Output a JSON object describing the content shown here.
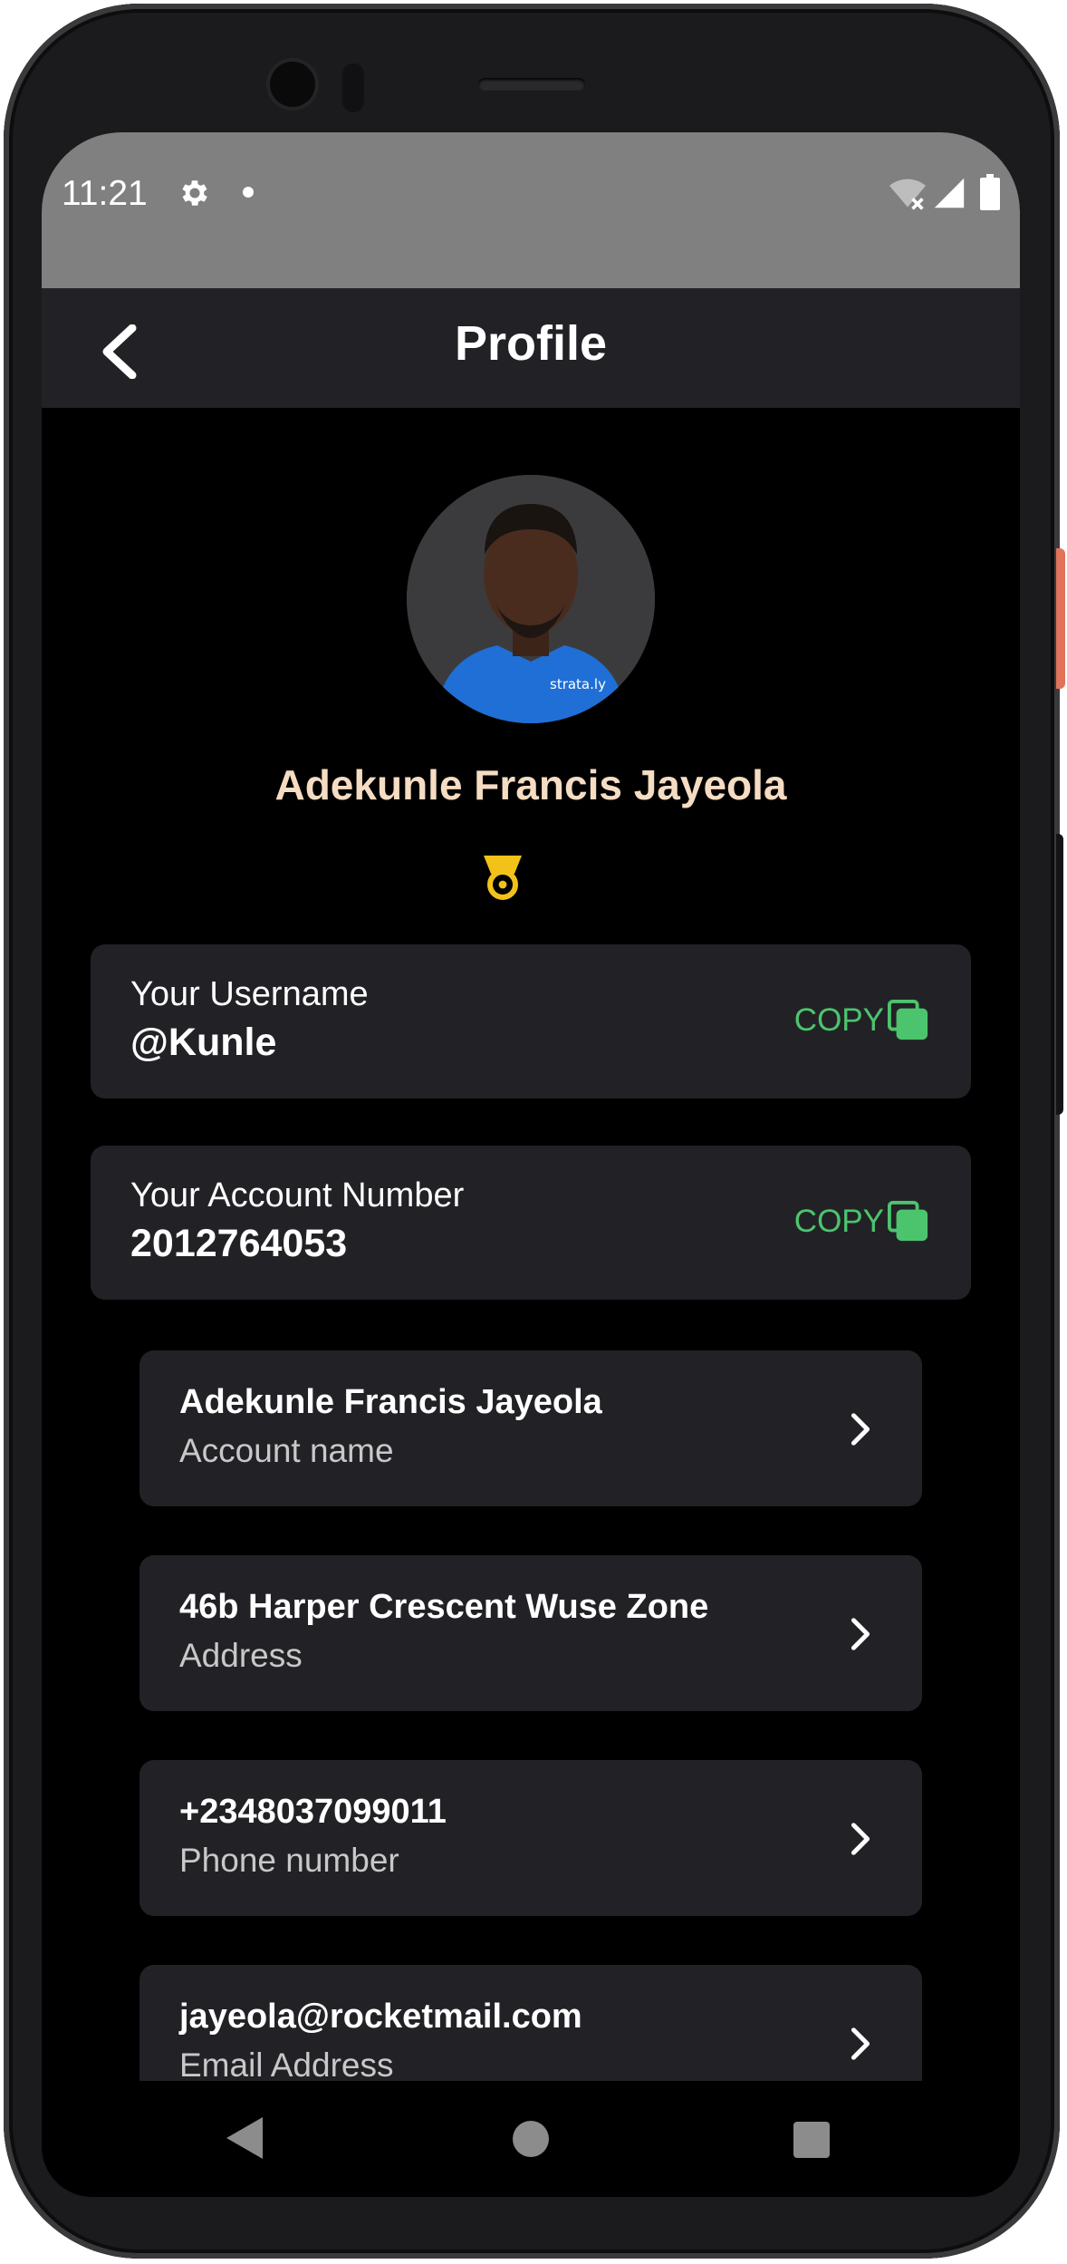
{
  "status_bar": {
    "time": "11:21",
    "icons": [
      "gear-icon",
      "notification-dot-icon",
      "wifi-off-icon",
      "cell-signal-icon",
      "battery-icon"
    ]
  },
  "app_bar": {
    "title": "Profile",
    "back_icon": "chevron-left-icon"
  },
  "profile": {
    "name": "Adekunle Francis Jayeola",
    "avatar_shirt_text": "strata.ly",
    "badge_icon": "medal-icon"
  },
  "username_card": {
    "label": "Your Username",
    "value": "@Kunle",
    "copy_label": "COPY"
  },
  "account_card": {
    "label": "Your Account Number",
    "value": "2012764053",
    "copy_label": "COPY"
  },
  "details": [
    {
      "value": "Adekunle Francis Jayeola",
      "label": "Account name"
    },
    {
      "value": "46b Harper Crescent Wuse Zone",
      "label": "Address"
    },
    {
      "value": "+2348037099011",
      "label": "Phone number"
    },
    {
      "value": "jayeola@rocketmail.com",
      "label": "Email Address"
    }
  ],
  "nav_bar": {
    "icons": [
      "back-triangle-icon",
      "home-circle-icon",
      "recents-square-icon"
    ]
  },
  "colors": {
    "background": "#000000",
    "card": "#222226",
    "status_bar": "#808080",
    "name_accent": "#f5dcc2",
    "copy_green": "#4cc46e",
    "badge_yellow": "#f2c218"
  }
}
